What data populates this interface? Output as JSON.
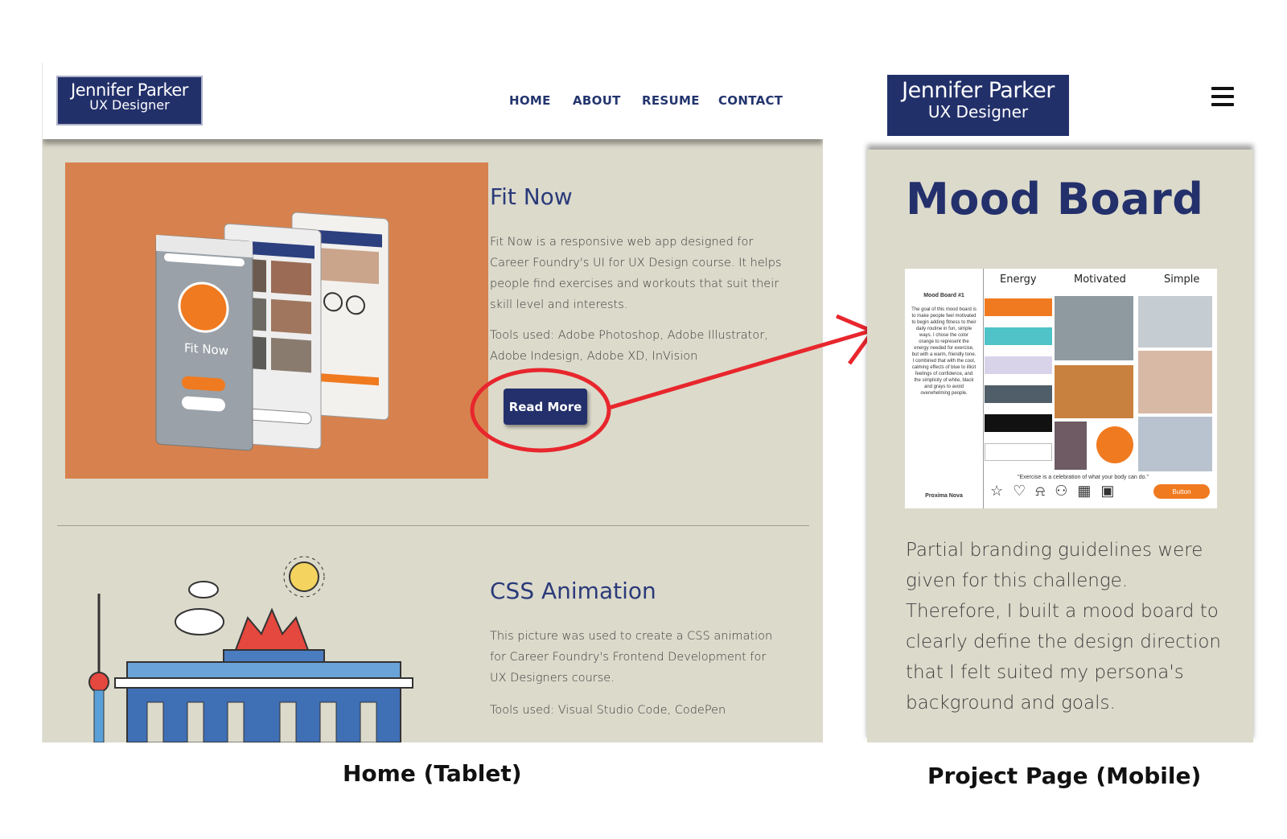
{
  "tablet": {
    "logo": {
      "name": "Jennifer Parker",
      "role": "UX Designer"
    },
    "nav": [
      "HOME",
      "ABOUT",
      "RESUME",
      "CONTACT"
    ],
    "project1": {
      "title": "Fit Now",
      "description": "Fit Now is a responsive web app designed for Career Foundry's UI for UX Design course. It helps people find exercises and workouts that suit their skill level and interests.",
      "tools": "Tools used: Adobe Photoshop, Adobe Illustrator, Adobe Indesign, Adobe XD, InVision",
      "button": "Read More",
      "image_text": "Fit Now"
    },
    "project2": {
      "title": "CSS Animation",
      "description": "This picture was used to create a CSS animation for Career Foundry's Frontend Development for UX Designers course.",
      "tools": "Tools used: Visual Studio Code, CodePen"
    }
  },
  "mobile": {
    "logo": {
      "name": "Jennifer Parker",
      "role": "UX Designer"
    },
    "title": "Mood Board",
    "body": "Partial branding guidelines were given for this challenge. Therefore, I built a mood board to clearly define the design direction that I felt suited my persona's background and goals.",
    "moodboard": {
      "heading": "Mood Board #1",
      "columns": [
        "Energy",
        "Motivated",
        "Simple"
      ],
      "side_text": "The goal of this mood board is to make people feel motivated to begin adding fitness to their daily routine in fun, simple ways. I chose the color orange to represent the energy needed for exercise, but with a warm, friendly tone. I combined that with the cool, calming effects of blue to illicit feelings of confidence, and the simplicity of white, black and grays to avoid overwhelming people.",
      "font": "Proxima Nova",
      "quote": "\"Exercise is a celebration of what your body can do.\"",
      "button": "Button",
      "swatches": [
        "#f07a20",
        "#4fc3c8",
        "#d9d3ea",
        "#4f5e68",
        "#111111",
        "#ffffff"
      ]
    }
  },
  "captions": {
    "left": "Home (Tablet)",
    "right": "Project Page (Mobile)"
  },
  "colors": {
    "brand_navy": "#23306b",
    "background": "#dcdacb",
    "accent_orange": "#d7824e",
    "annotation_red": "#e8262d"
  }
}
